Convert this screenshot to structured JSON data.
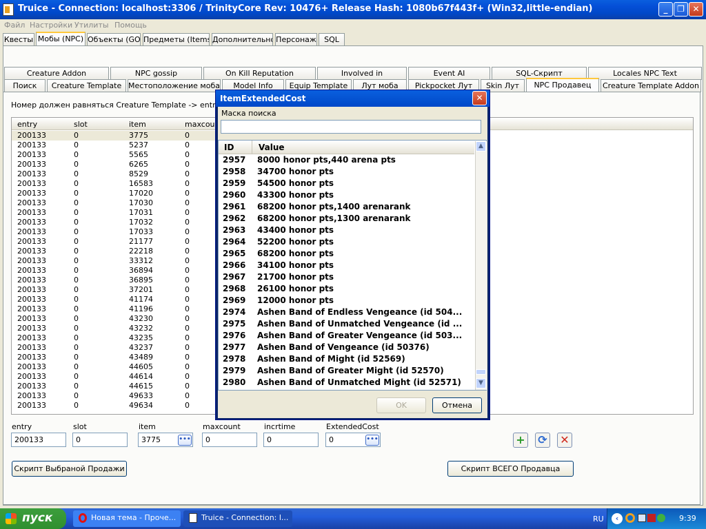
{
  "window": {
    "title": "Truice - Connection: localhost:3306 / TrinityCore Rev: 10476+ Release Hash: 1080b67f443f+ (Win32,little-endian)"
  },
  "menu": [
    "Файл",
    "Настройки",
    "Утилиты",
    "Помощь"
  ],
  "main_tabs": [
    "Квесты",
    "Мобы (NPC)",
    "Объекты (GO)",
    "Предметы (Items)",
    "Дополнительно",
    "Персонаж",
    "SQL"
  ],
  "sub_tabs_row1": [
    "Creature Addon",
    "NPC gossip",
    "On Kill Reputation",
    "Involved in",
    "Event AI",
    "SQL-Скрипт",
    "Locales NPC Text"
  ],
  "sub_tabs_row2": [
    "Поиск",
    "Creature Template",
    "Местоположение моба",
    "Model Info",
    "Equip Template",
    "Лут моба",
    "Pickpocket Лут",
    "Skin Лут",
    "NPC Продавец",
    "Creature Template Addon"
  ],
  "info_text": "Номер должен равняться Creature Template -> entry",
  "grid": {
    "columns": [
      "entry",
      "slot",
      "item",
      "maxcount"
    ],
    "rows": [
      [
        "200133",
        "0",
        "3775",
        "0"
      ],
      [
        "200133",
        "0",
        "5237",
        "0"
      ],
      [
        "200133",
        "0",
        "5565",
        "0"
      ],
      [
        "200133",
        "0",
        "6265",
        "0"
      ],
      [
        "200133",
        "0",
        "8529",
        "0"
      ],
      [
        "200133",
        "0",
        "16583",
        "0"
      ],
      [
        "200133",
        "0",
        "17020",
        "0"
      ],
      [
        "200133",
        "0",
        "17030",
        "0"
      ],
      [
        "200133",
        "0",
        "17031",
        "0"
      ],
      [
        "200133",
        "0",
        "17032",
        "0"
      ],
      [
        "200133",
        "0",
        "17033",
        "0"
      ],
      [
        "200133",
        "0",
        "21177",
        "0"
      ],
      [
        "200133",
        "0",
        "22218",
        "0"
      ],
      [
        "200133",
        "0",
        "33312",
        "0"
      ],
      [
        "200133",
        "0",
        "36894",
        "0"
      ],
      [
        "200133",
        "0",
        "36895",
        "0"
      ],
      [
        "200133",
        "0",
        "37201",
        "0"
      ],
      [
        "200133",
        "0",
        "41174",
        "0"
      ],
      [
        "200133",
        "0",
        "41196",
        "0"
      ],
      [
        "200133",
        "0",
        "43230",
        "0"
      ],
      [
        "200133",
        "0",
        "43232",
        "0"
      ],
      [
        "200133",
        "0",
        "43235",
        "0"
      ],
      [
        "200133",
        "0",
        "43237",
        "0"
      ],
      [
        "200133",
        "0",
        "43489",
        "0"
      ],
      [
        "200133",
        "0",
        "44605",
        "0"
      ],
      [
        "200133",
        "0",
        "44614",
        "0"
      ],
      [
        "200133",
        "0",
        "44615",
        "0"
      ],
      [
        "200133",
        "0",
        "49633",
        "0"
      ],
      [
        "200133",
        "0",
        "49634",
        "0"
      ]
    ]
  },
  "form": {
    "entry_label": "entry",
    "entry_value": "200133",
    "slot_label": "slot",
    "slot_value": "0",
    "item_label": "item",
    "item_value": "3775",
    "maxcount_label": "maxcount",
    "maxcount_value": "0",
    "incrtime_label": "incrtime",
    "incrtime_value": "0",
    "extcost_label": "ExtendedCost",
    "extcost_value": "0",
    "dots": "•••"
  },
  "buttons": {
    "script_selected": "Скрипт Выбраной Продажи",
    "script_all": "Скрипт ВСЕГО Продавца",
    "add": "+",
    "refresh": "⟳",
    "delete": "✕"
  },
  "dialog": {
    "title": "ItemExtendedCost",
    "close": "✕",
    "search_label": "Маска поиска",
    "search_value": "",
    "col_id": "ID",
    "col_value": "Value",
    "ok": "OK",
    "cancel": "Отмена",
    "rows": [
      [
        "2957",
        "8000 honor pts,440 arena pts"
      ],
      [
        "2958",
        "34700 honor pts"
      ],
      [
        "2959",
        "54500 honor pts"
      ],
      [
        "2960",
        "43300 honor pts"
      ],
      [
        "2961",
        "68200 honor pts,1400 arenarank"
      ],
      [
        "2962",
        "68200 honor pts,1300 arenarank"
      ],
      [
        "2963",
        "43400 honor pts"
      ],
      [
        "2964",
        "52200 honor pts"
      ],
      [
        "2965",
        "68200 honor pts"
      ],
      [
        "2966",
        "34100 honor pts"
      ],
      [
        "2967",
        "21700 honor pts"
      ],
      [
        "2968",
        "26100 honor pts"
      ],
      [
        "2969",
        "12000 honor pts"
      ],
      [
        "2974",
        "Ashen Band of Endless Vengeance (id 504..."
      ],
      [
        "2975",
        "Ashen Band of Unmatched Vengeance (id ..."
      ],
      [
        "2976",
        "Ashen Band of Greater Vengeance (id 503..."
      ],
      [
        "2977",
        "Ashen Band of Vengeance (id 50376)"
      ],
      [
        "2978",
        "Ashen Band of Might (id 52569)"
      ],
      [
        "2979",
        "Ashen Band of Greater Might (id 52570)"
      ],
      [
        "2980",
        "Ashen Band of Unmatched Might (id 52571)"
      ]
    ]
  },
  "taskbar": {
    "start": "пуск",
    "task1": "Новая тема - Проче...",
    "task2": "Truice - Connection: l...",
    "lang": "RU",
    "time": "9:39"
  }
}
